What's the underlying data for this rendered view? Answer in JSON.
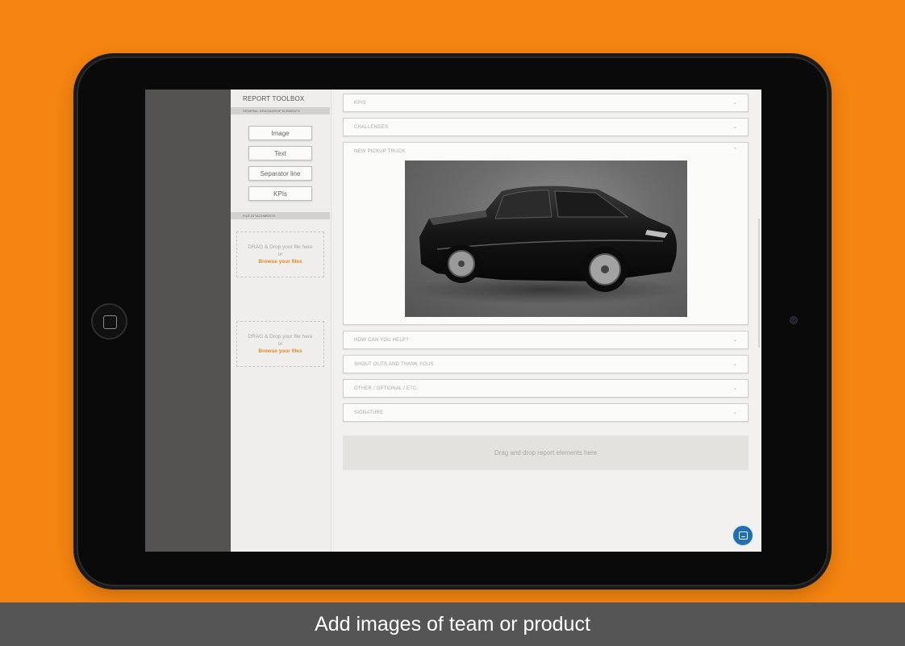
{
  "caption": "Add images of team or product",
  "toolbox": {
    "title": "REPORT TOOLBOX",
    "general_section": "GENERAL DRAG&DROP ELEMENTS",
    "buttons": [
      "Image",
      "Text",
      "Separator line",
      "KPIs"
    ],
    "file_section": "FILE ATTACHMENTS",
    "dropzones": [
      {
        "line1": "DRAG & Drop your file here",
        "line2": "or",
        "link": "Browse your files"
      },
      {
        "line1": "DRAG & Drop your file here",
        "line2": "or",
        "link": "Browse your files"
      }
    ]
  },
  "panels": [
    {
      "title": "KPIS",
      "state": "collapsed"
    },
    {
      "title": "CHALLENGES",
      "state": "collapsed"
    },
    {
      "title": "NEW PICKUP TRUCK",
      "state": "expanded",
      "content": "pickup-truck-image"
    },
    {
      "title": "HOW CAN YOU HELP?",
      "state": "collapsed"
    },
    {
      "title": "SHOUT OUTS AND THANK YOUS",
      "state": "collapsed"
    },
    {
      "title": "OTHER / OPTIONAL / ETC.",
      "state": "collapsed"
    },
    {
      "title": "SIGNATURE",
      "state": "collapsed"
    }
  ],
  "drop_area": {
    "label": "Drag and drop report elements here"
  },
  "icons": {
    "expand": "chevron-down-icon",
    "collapse": "chevron-up-icon",
    "chat": "chat-icon",
    "home": "home-button-icon"
  },
  "colors": {
    "background": "#f58410",
    "accent": "#e58a1e",
    "chat": "#1f6fb2",
    "caption_band": "#555555"
  }
}
